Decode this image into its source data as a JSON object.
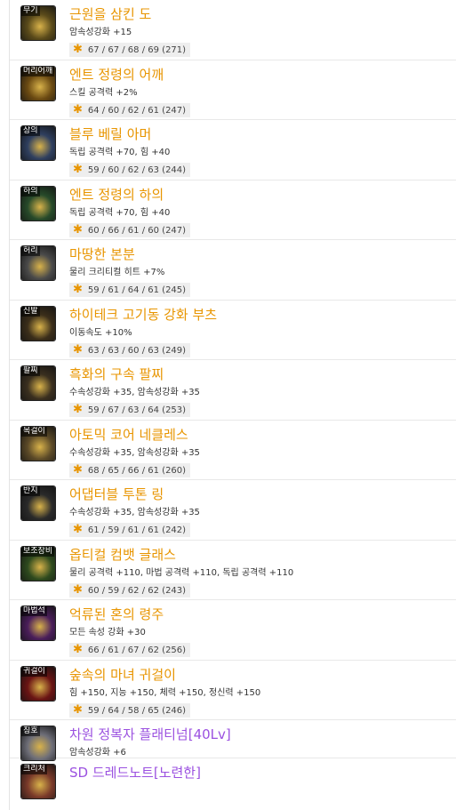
{
  "items": [
    {
      "slot": "무기",
      "name": "근원을 삼킨 도",
      "stat": "암속성강화 +15",
      "score": "67 / 67 / 68 / 69 (271)",
      "color": "#e89500",
      "art": "#5a4a1a"
    },
    {
      "slot": "머리어깨",
      "name": "엔트 정령의 어깨",
      "stat": "스킬 공격력 +2%",
      "score": "64 / 60 / 62 / 61 (247)",
      "color": "#e89500",
      "art": "#6b4a12"
    },
    {
      "slot": "상의",
      "name": "블루 베릴 아머",
      "stat": "독립 공격력 +70, 힘 +40",
      "score": "59 / 60 / 62 / 63 (244)",
      "color": "#e89500",
      "art": "#2f3f5f"
    },
    {
      "slot": "하의",
      "name": "엔트 정령의 하의",
      "stat": "독립 공격력 +70, 힘 +40",
      "score": "60 / 66 / 61 / 60 (247)",
      "color": "#e89500",
      "art": "#274a2a"
    },
    {
      "slot": "허리",
      "name": "마땅한 본분",
      "stat": "물리 크리티컬 히트 +7%",
      "score": "59 / 61 / 64 / 61 (245)",
      "color": "#e89500",
      "art": "#4a4a4a"
    },
    {
      "slot": "신발",
      "name": "하이테크 고기동 강화 부츠",
      "stat": "이동속도 +10%",
      "score": "63 / 63 / 60 / 63 (249)",
      "color": "#e89500",
      "art": "#3b2e1a"
    },
    {
      "slot": "팔찌",
      "name": "흑화의 구속 팔찌",
      "stat": "수속성강화 +35, 암속성강화 +35",
      "score": "59 / 67 / 63 / 64 (253)",
      "color": "#e89500",
      "art": "#3a2f1f"
    },
    {
      "slot": "목걸이",
      "name": "아토믹 코어 네클레스",
      "stat": "수속성강화 +35, 암속성강화 +35",
      "score": "68 / 65 / 66 / 61 (260)",
      "color": "#e89500",
      "art": "#5c4a28"
    },
    {
      "slot": "반지",
      "name": "어댑터블 투톤 링",
      "stat": "수속성강화 +35, 암속성강화 +35",
      "score": "61 / 59 / 61 / 61 (242)",
      "color": "#e89500",
      "art": "#2a2a2a"
    },
    {
      "slot": "보조장비",
      "name": "옵티컬 컴뱃 글래스",
      "stat": "물리 공격력 +110, 마법 공격력 +110, 독립 공격력 +110",
      "score": "60 / 59 / 62 / 62 (243)",
      "color": "#e89500",
      "art": "#2e4a1e"
    },
    {
      "slot": "마법석",
      "name": "억류된 혼의 령주",
      "stat": "모든 속성 강화 +30",
      "score": "66 / 61 / 67 / 62 (256)",
      "color": "#e89500",
      "art": "#4a1e5a"
    },
    {
      "slot": "귀걸이",
      "name": "숲속의 마녀 귀걸이",
      "stat": "힘 +150, 지능 +150, 체력 +150, 정신력 +150",
      "score": "59 / 64 / 58 / 65 (246)",
      "color": "#e89500",
      "art": "#6a1414"
    },
    {
      "slot": "칭호",
      "name": "차원 정복자 플래티넘[40Lv]",
      "stat": "암속성강화 +6",
      "score": "",
      "color": "#9b51e0",
      "art": "#6e6e78"
    },
    {
      "slot": "크리처",
      "name": "SD 드레드노트[노련한]",
      "stat": "",
      "score": "",
      "color": "#9b51e0",
      "art": "#7a3a2a"
    }
  ]
}
